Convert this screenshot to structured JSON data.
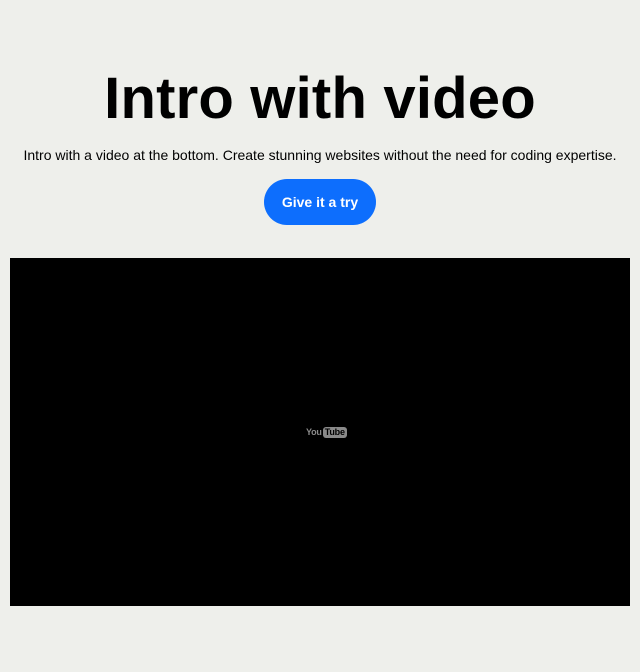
{
  "hero": {
    "title": "Intro with video",
    "subtitle": "Intro with a video at the bottom. Create stunning websites without the need for coding expertise.",
    "cta_label": "Give it a try"
  },
  "video": {
    "logo_you": "You",
    "logo_tube": "Tube"
  },
  "colors": {
    "background": "#eeefeb",
    "accent": "#0d6efd",
    "video_bg": "#000000"
  }
}
